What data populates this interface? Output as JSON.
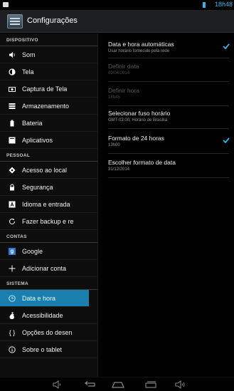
{
  "status_bar": {
    "time": "18h48"
  },
  "action_bar": {
    "title": "Configurações"
  },
  "sidebar": {
    "sections": [
      {
        "header": "DISPOSITIVO",
        "items": [
          {
            "label": "Som",
            "icon": "speaker-icon"
          },
          {
            "label": "Tela",
            "icon": "brightness-icon"
          },
          {
            "label": "Captura de Tela",
            "icon": "camera-icon"
          },
          {
            "label": "Armazenamento",
            "icon": "storage-icon"
          },
          {
            "label": "Bateria",
            "icon": "battery-icon"
          },
          {
            "label": "Aplicativos",
            "icon": "apps-icon"
          }
        ]
      },
      {
        "header": "PESSOAL",
        "items": [
          {
            "label": "Acesso ao local",
            "icon": "location-icon"
          },
          {
            "label": "Segurança",
            "icon": "lock-icon"
          },
          {
            "label": "Idioma e entrada",
            "icon": "keyboard-icon"
          },
          {
            "label": "Fazer backup e re",
            "icon": "backup-icon"
          }
        ]
      },
      {
        "header": "CONTAS",
        "items": [
          {
            "label": "Google",
            "icon": "google-icon"
          },
          {
            "label": "Adicionar conta",
            "icon": "plus-icon"
          }
        ]
      },
      {
        "header": "SISTEMA",
        "items": [
          {
            "label": "Data e hora",
            "icon": "clock-icon",
            "active": true
          },
          {
            "label": "Acessibilidade",
            "icon": "accessibility-icon"
          },
          {
            "label": "Opções do desen",
            "icon": "code-icon"
          },
          {
            "label": "Sobre o tablet",
            "icon": "info-icon"
          }
        ]
      }
    ]
  },
  "settings": [
    {
      "title": "Data e hora automáticas",
      "summary": "Usar horário fornecido pela rede",
      "checked": true,
      "enabled": true
    },
    {
      "title": "Definir data",
      "summary": "09/04/2014",
      "checked": false,
      "enabled": false
    },
    {
      "title": "Definir hora",
      "summary": "18h48",
      "checked": false,
      "enabled": false
    },
    {
      "title": "Selecionar fuso horário",
      "summary": "GMT-03:00, Horário de Brasília",
      "checked": false,
      "enabled": true
    },
    {
      "title": "Formato de 24 horas",
      "summary": "13h00",
      "checked": true,
      "enabled": true
    },
    {
      "title": "Escolher formato de data",
      "summary": "31/12/2014",
      "checked": false,
      "enabled": true
    }
  ],
  "colors": {
    "accent": "#33b5e5",
    "active_bg": "#1a7fae"
  }
}
